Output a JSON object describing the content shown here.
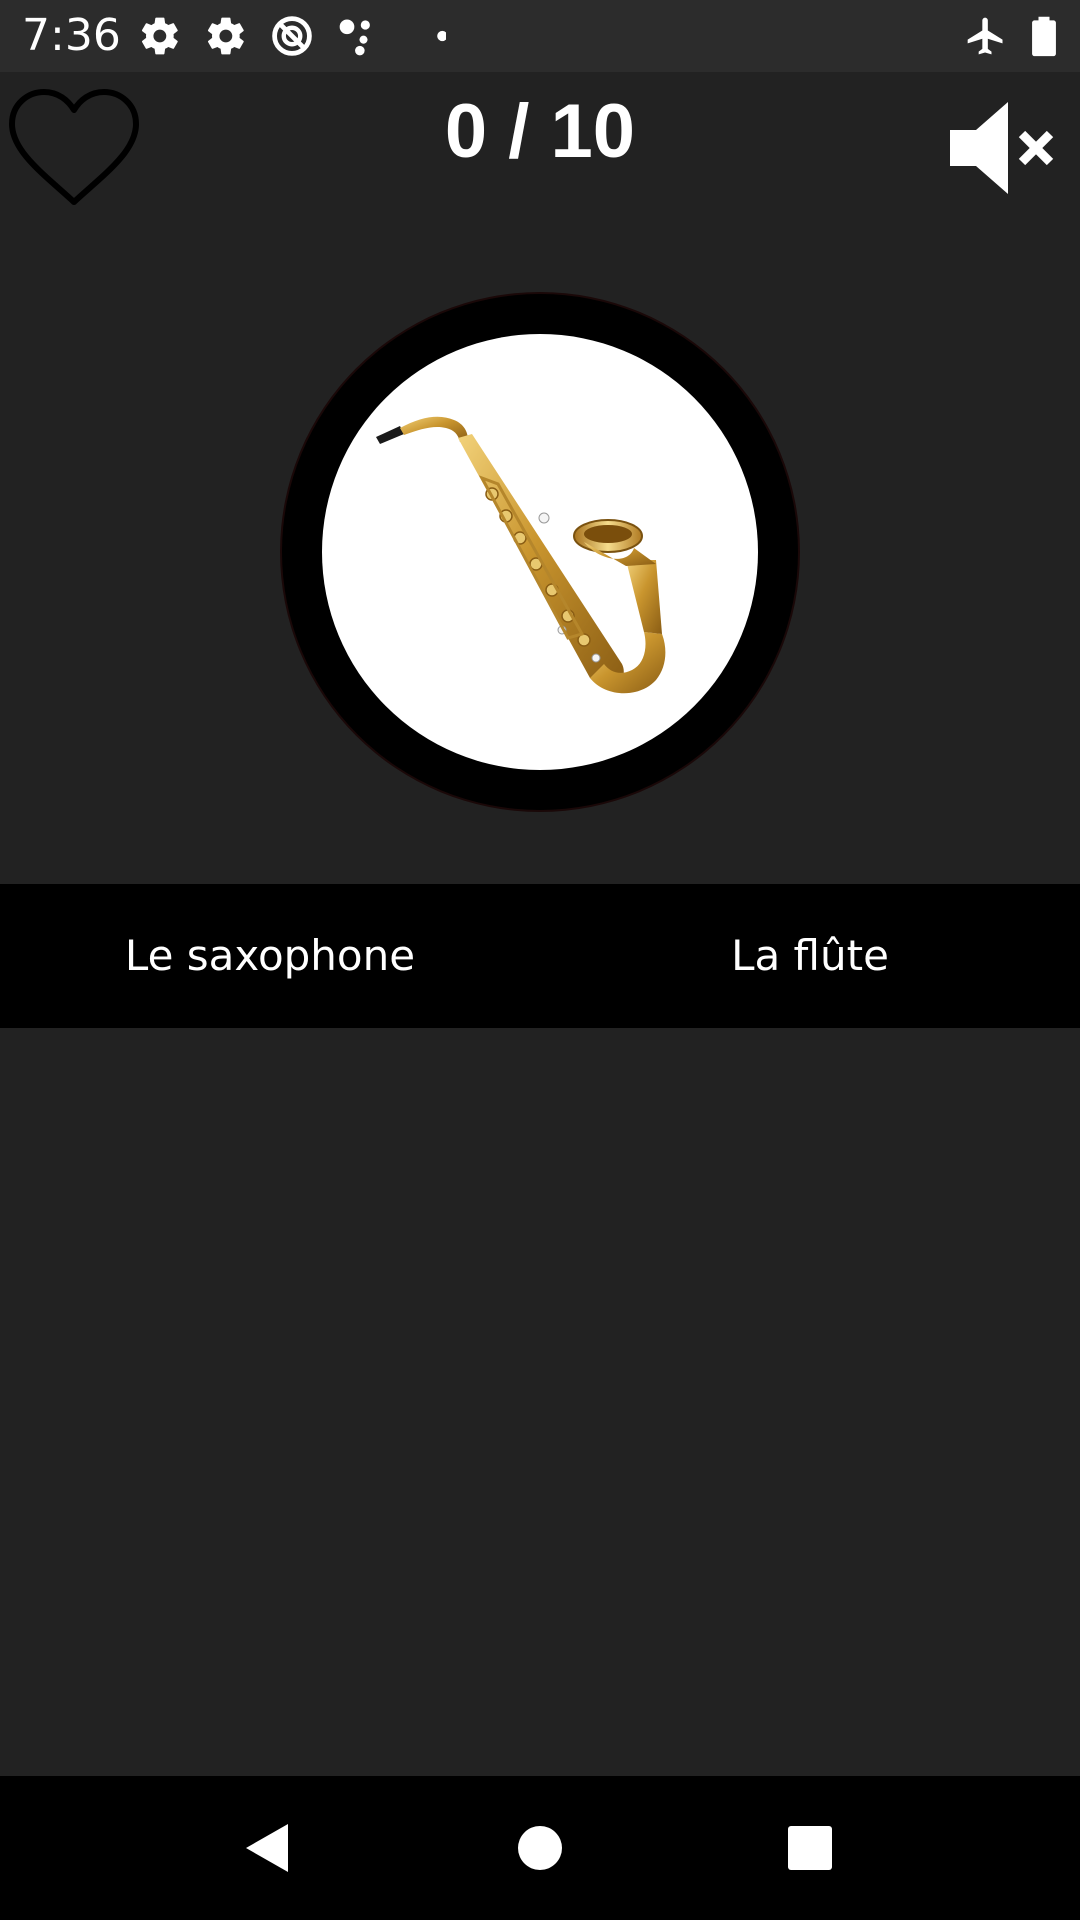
{
  "status_bar": {
    "time": "7:36",
    "icons_left": [
      "settings-icon",
      "settings-icon",
      "do-not-disturb-icon",
      "assistant-dots-icon",
      "notification-dot-icon"
    ],
    "icons_right": [
      "airplane-mode-icon",
      "battery-icon"
    ]
  },
  "top_bar": {
    "score": "0 / 10",
    "favorite_icon": "heart-outline-icon",
    "sound_icon": "volume-muted-icon"
  },
  "question": {
    "image_subject": "saxophone",
    "ring_color": "#000000",
    "disc_color": "#ffffff"
  },
  "answers": {
    "left": "Le saxophone",
    "right": "La flûte"
  },
  "nav_bar": {
    "buttons": [
      "back-icon",
      "home-icon",
      "recents-icon"
    ]
  },
  "colors": {
    "background": "#222222",
    "status_bar": "#2c2c2c",
    "answer_bar": "#000000",
    "text": "#ffffff"
  }
}
